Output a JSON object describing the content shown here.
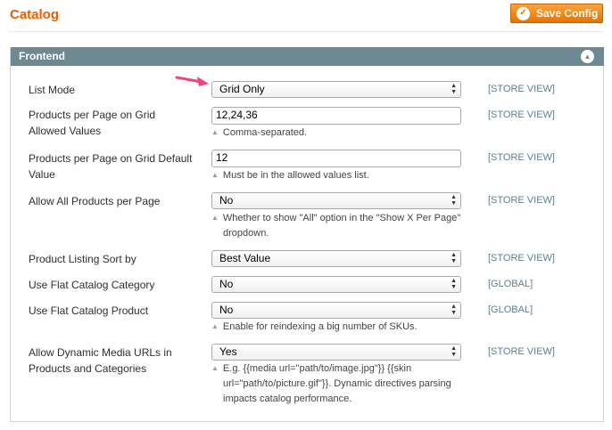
{
  "page": {
    "title": "Catalog",
    "save_label": "Save Config",
    "accent_color": "#eb5e00"
  },
  "section": {
    "title": "Frontend",
    "header_color": "#6f8992"
  },
  "fields": {
    "list_mode": {
      "label": "List Mode",
      "value": "Grid Only",
      "scope": "[STORE VIEW]"
    },
    "grid_allowed": {
      "label_1": "Products per Page on Grid",
      "label_2": "Allowed Values",
      "value": "12,24,36",
      "note": "Comma-separated.",
      "scope": "[STORE VIEW]"
    },
    "grid_default": {
      "label_1": "Products per Page on Grid Default",
      "label_2": "Value",
      "value": "12",
      "note": "Must be in the allowed values list.",
      "scope": "[STORE VIEW]"
    },
    "allow_all": {
      "label": "Allow All Products per Page",
      "value": "No",
      "note_1": "Whether to show \"All\" option in the \"Show X Per Page\"",
      "note_2": "dropdown.",
      "scope": "[STORE VIEW]"
    },
    "sort_by": {
      "label": "Product Listing Sort by",
      "value": "Best Value",
      "scope": "[STORE VIEW]"
    },
    "flat_category": {
      "label": "Use Flat Catalog Category",
      "value": "No",
      "scope": "[GLOBAL]"
    },
    "flat_product": {
      "label": "Use Flat Catalog Product",
      "value": "No",
      "note": "Enable for reindexing a big number of SKUs.",
      "scope": "[GLOBAL]"
    },
    "dynamic_media": {
      "label_1": "Allow Dynamic Media URLs in",
      "label_2": "Products and Categories",
      "value": "Yes",
      "note_1": "E.g. {{media url=\"path/to/image.jpg\"}} {{skin",
      "note_2": "url=\"path/to/picture.gif\"}}. Dynamic directives parsing",
      "note_3": "impacts catalog performance.",
      "scope": "[STORE VIEW]"
    }
  }
}
